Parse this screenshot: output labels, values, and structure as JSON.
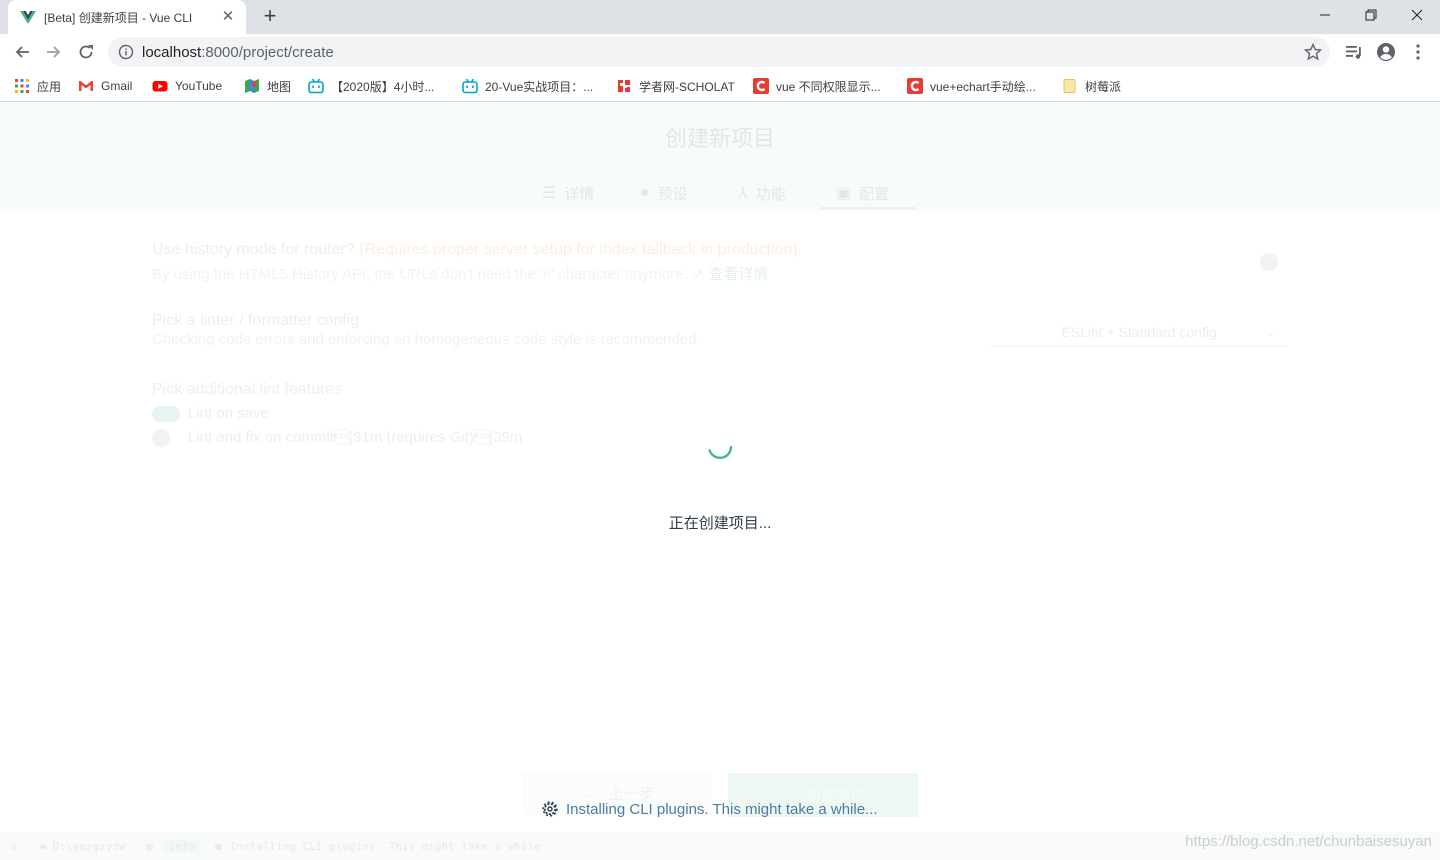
{
  "browser": {
    "tab_title": "[Beta] 创建新项目 - Vue CLI",
    "tab_close": "✕",
    "new_tab": "+",
    "url_host": "localhost",
    "url_path": ":8000/project/create",
    "bookmarks": [
      {
        "label": "应用",
        "icon": "apps-grid-icon"
      },
      {
        "label": "Gmail",
        "icon": "gmail-icon"
      },
      {
        "label": "YouTube",
        "icon": "youtube-icon"
      },
      {
        "label": "地图",
        "icon": "maps-icon"
      },
      {
        "label": "【2020版】4小时...",
        "icon": "bilibili-icon"
      },
      {
        "label": "20-Vue实战项目：...",
        "icon": "bilibili-icon"
      },
      {
        "label": "学者网-SCHOLAT",
        "icon": "scholat-icon"
      },
      {
        "label": "vue 不同权限显示...",
        "icon": "csdn-icon"
      },
      {
        "label": "vue+echart手动绘...",
        "icon": "csdn-icon"
      },
      {
        "label": "树莓派",
        "icon": "folder-icon"
      }
    ]
  },
  "page": {
    "title": "创建新项目",
    "steps": [
      {
        "label": "详情",
        "icon": "list-icon"
      },
      {
        "label": "预设",
        "icon": "check-circle-icon"
      },
      {
        "label": "功能",
        "icon": "split-icon"
      },
      {
        "label": "配置",
        "icon": "settings-box-icon"
      }
    ],
    "config": {
      "router_title": "Use history mode for router?",
      "router_hint": "(Requires proper server setup for index fallback in production)",
      "router_desc": "By using the HTML5 History API, the URLs don't need the '#' character anymore.",
      "router_more": "查看详情",
      "linter_title": "Pick a linter / formatter config",
      "linter_desc": "Checking code errors and enforcing an homogeneous code style is recommended.",
      "linter_value": "ESLint + Standard config",
      "lint_features_title": "Pick additional lint features",
      "lint_on_save": "Lint on save",
      "lint_on_commit": "Lint and fix on commit\u001b[31m (requires Git)\u001b[39m"
    },
    "loading_text": "正在创建项目...",
    "prev_button": "上一步",
    "create_button": "创建项目",
    "install_message": "Installing CLI plugins. This might take a while..."
  },
  "statusbar": {
    "folder": "D:\\ymzgzyzw",
    "log_badge": "info",
    "log_message": "Installing CLI plugins. This might take a while"
  },
  "watermark": "https://blog.csdn.net/chunbaisesuyan",
  "colors": {
    "vue_green": "#42b983",
    "install_text": "#4f7aa3"
  }
}
